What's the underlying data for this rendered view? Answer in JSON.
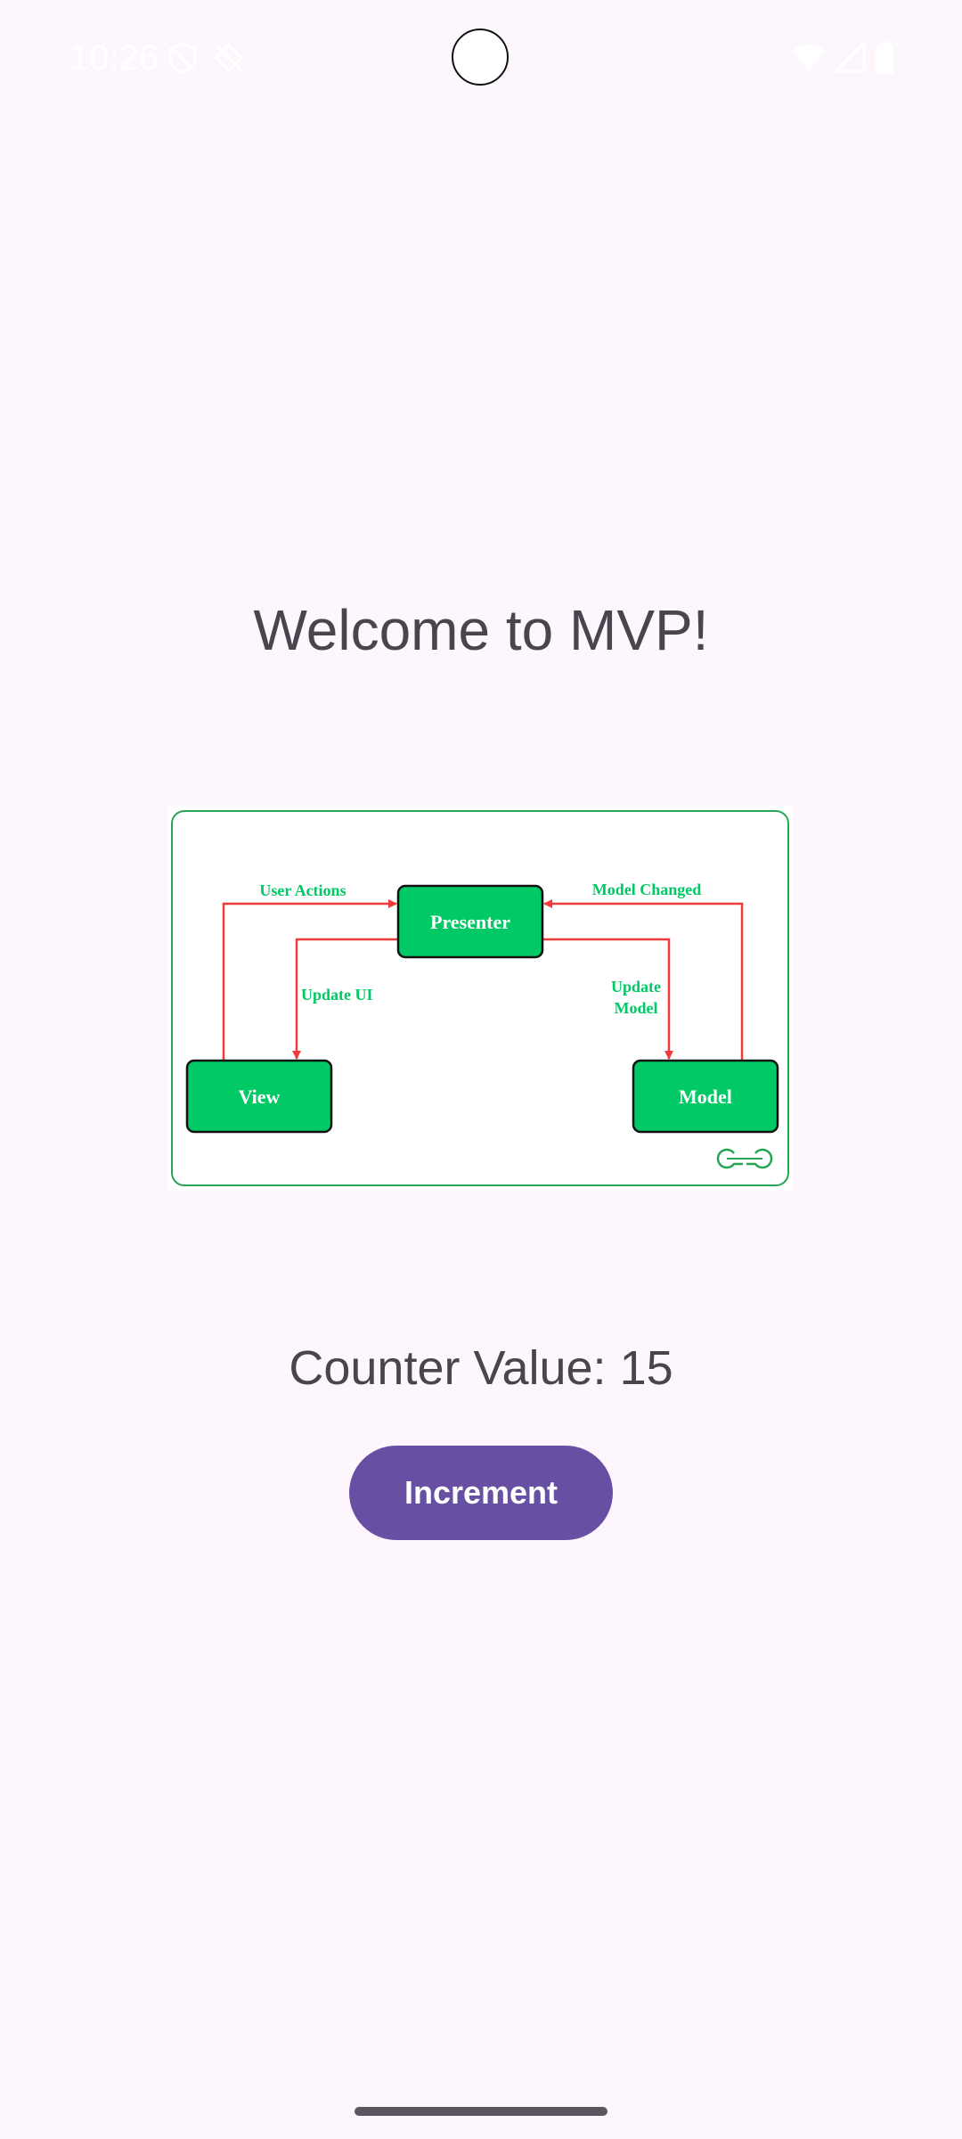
{
  "status_bar": {
    "time": "10:26",
    "icons": [
      "shield-icon",
      "location-off-icon",
      "wifi-icon",
      "signal-icon",
      "battery-icon"
    ]
  },
  "main": {
    "title": "Welcome to MVP!",
    "counter_text": "Counter Value: 15",
    "increment_label": "Increment"
  },
  "diagram": {
    "nodes": {
      "presenter": "Presenter",
      "view": "View",
      "model": "Model"
    },
    "edges": {
      "user_actions": "User Actions",
      "update_ui": "Update UI",
      "model_changed": "Model Changed",
      "update_model_line1": "Update",
      "update_model_line2": "Model"
    },
    "logo": "GG"
  },
  "colors": {
    "background": "#fdf6fd",
    "accent": "#6750a4",
    "node_fill": "#00c965",
    "arrow": "#ef3b3b",
    "label_green": "#00c965"
  }
}
